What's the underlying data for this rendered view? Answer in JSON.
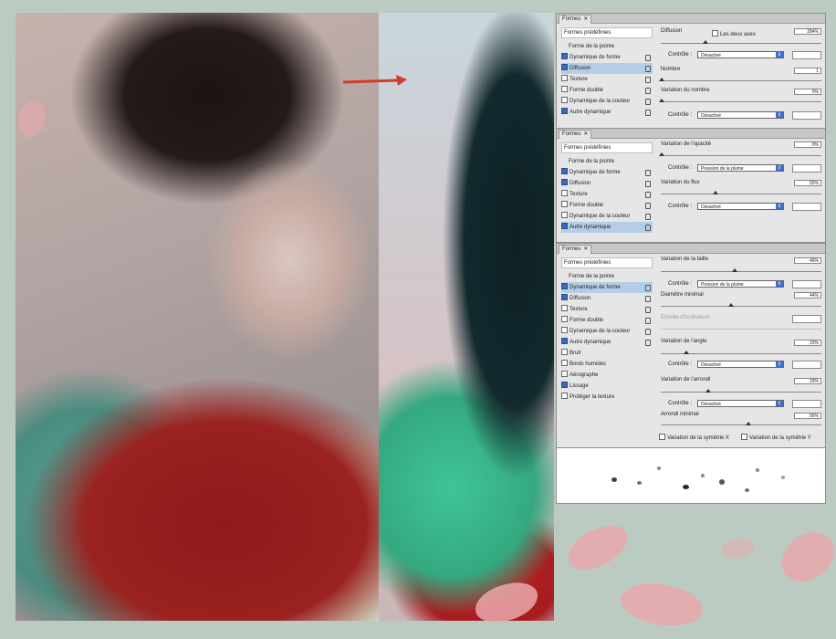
{
  "panel1": {
    "tab": "Formes",
    "list": {
      "header": "Formes prédéfinies",
      "items": [
        {
          "label": "Forme de la pointe",
          "type": "plain"
        },
        {
          "label": "Dynamique de forme",
          "checked": true
        },
        {
          "label": "Diffusion",
          "checked": true,
          "selected": true
        },
        {
          "label": "Texture",
          "checked": false
        },
        {
          "label": "Forme double",
          "checked": false
        },
        {
          "label": "Dynamique de la couleur",
          "checked": false
        },
        {
          "label": "Autre dynamique",
          "checked": true
        }
      ]
    },
    "options": {
      "diffusion_label": "Diffusion",
      "les_deux_axes": "Les deux axes",
      "diffusion_value": "284%",
      "controle_label": "Contrôle :",
      "controle_value": "Désactivé",
      "nombre_label": "Nombre",
      "nombre_value": "1",
      "variation_label": "Variation du nombre",
      "variation_value": "0%",
      "controle2_label": "Contrôle :",
      "controle2_value": "Désactivé"
    }
  },
  "panel2": {
    "tab": "Formes",
    "list": {
      "header": "Formes prédéfinies",
      "items": [
        {
          "label": "Forme de la pointe",
          "type": "plain"
        },
        {
          "label": "Dynamique de forme",
          "checked": true
        },
        {
          "label": "Diffusion",
          "checked": true
        },
        {
          "label": "Texture",
          "checked": false
        },
        {
          "label": "Forme double",
          "checked": false
        },
        {
          "label": "Dynamique de la couleur",
          "checked": false
        },
        {
          "label": "Autre dynamique",
          "checked": true,
          "selected": true
        }
      ]
    },
    "options": {
      "opacite_label": "Variation de l'opacité",
      "opacite_value": "0%",
      "controle_label": "Contrôle :",
      "controle_value": "Pression de la plume",
      "flux_label": "Variation du flux",
      "flux_value": "55%",
      "controle2_label": "Contrôle :",
      "controle2_value": "Désactivé"
    }
  },
  "panel3": {
    "tab": "Formes",
    "list": {
      "header": "Formes prédéfinies",
      "items": [
        {
          "label": "Forme de la pointe",
          "type": "plain"
        },
        {
          "label": "Dynamique de forme",
          "checked": true,
          "selected": true
        },
        {
          "label": "Diffusion",
          "checked": true
        },
        {
          "label": "Texture",
          "checked": false
        },
        {
          "label": "Forme double",
          "checked": false
        },
        {
          "label": "Dynamique de la couleur",
          "checked": false
        },
        {
          "label": "Autre dynamique",
          "checked": true
        },
        {
          "label": "Bruit",
          "checked": false
        },
        {
          "label": "Bords humides",
          "checked": false
        },
        {
          "label": "Aérographe",
          "checked": false
        },
        {
          "label": "Lissage",
          "checked": true
        },
        {
          "label": "Protéger la texture",
          "checked": false
        }
      ]
    },
    "options": {
      "taille_label": "Variation de la taille",
      "taille_value": "46%",
      "controle_label": "Contrôle :",
      "controle_value": "Pression de la plume",
      "diametre_label": "Diamètre minimal",
      "diametre_value": "44%",
      "echelle_label": "Echelle d'inclinaison",
      "angle_label": "Variation de l'angle",
      "angle_value": "15%",
      "controle2_label": "Contrôle :",
      "controle2_value": "Désactivé",
      "arrondi_label": "Variation de l'arrondi",
      "arrondi_value": "29%",
      "controle3_label": "Contrôle :",
      "controle3_value": "Désactivé",
      "arrondi_min_label": "Arrondi minimal",
      "arrondi_min_value": "56%",
      "sym_x": "Variation de la symétrie X",
      "sym_y": "Variation de la symétrie Y"
    }
  },
  "colors": {
    "accent": "#3e6fd1",
    "selected_row": "#b6cde8",
    "arrow": "#d63a2a"
  }
}
